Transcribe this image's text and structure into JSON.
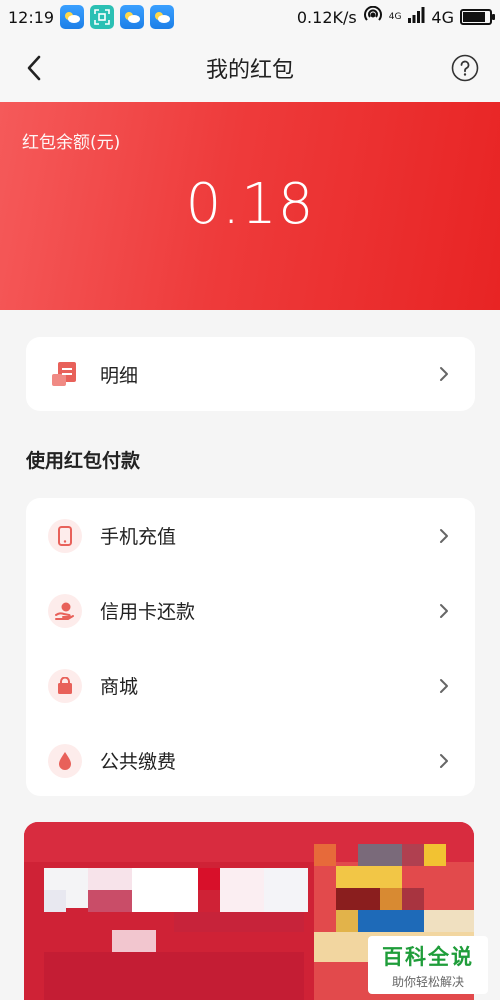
{
  "status_bar": {
    "time": "12:19",
    "network_speed": "0.12K/s",
    "signal_label_small": "4G",
    "network_type": "4G",
    "battery_level": 0.85
  },
  "nav": {
    "title": "我的红包"
  },
  "balance": {
    "label": "红包余额(元)",
    "amount": "0.18"
  },
  "detail": {
    "label": "明细"
  },
  "pay_section": {
    "title": "使用红包付款",
    "items": [
      {
        "label": "手机充值",
        "icon": "phone-icon"
      },
      {
        "label": "信用卡还款",
        "icon": "credit-card-repay-icon"
      },
      {
        "label": "商城",
        "icon": "shopping-bag-icon"
      },
      {
        "label": "公共缴费",
        "icon": "water-drop-icon"
      }
    ]
  },
  "watermark": {
    "title": "百科全说",
    "subtitle": "助你轻松解决"
  },
  "colors": {
    "accent": "#ee3b3b",
    "icon_accent": "#e8615a",
    "icon_bg": "#fdeceb"
  }
}
